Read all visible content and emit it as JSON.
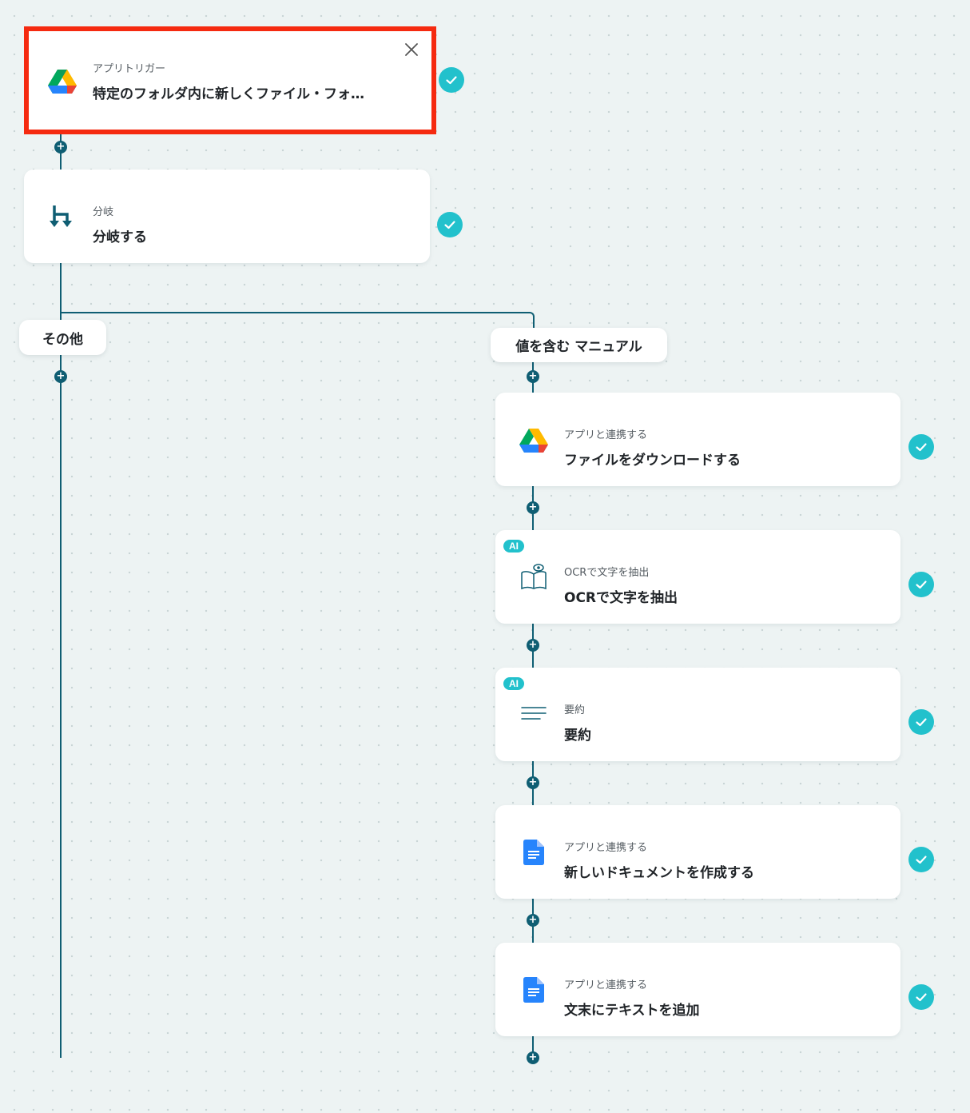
{
  "trigger": {
    "sub": "アプリトリガー",
    "main": "特定のフォルダ内に新しくファイル・フォ…",
    "icon": "google-drive-icon"
  },
  "branch": {
    "sub": "分岐",
    "main": "分岐する",
    "icon": "branch-icon"
  },
  "branches": {
    "left": "その他",
    "right": "値を含む マニュアル"
  },
  "steps": [
    {
      "sub": "アプリと連携する",
      "main": "ファイルをダウンロードする",
      "icon": "google-drive-icon",
      "ai": false
    },
    {
      "sub": "OCRで文字を抽出",
      "main": "OCRで文字を抽出",
      "icon": "ocr-book-icon",
      "ai": true,
      "badge": "AI"
    },
    {
      "sub": "要約",
      "main": "要約",
      "icon": "summary-lines-icon",
      "ai": true,
      "badge": "AI"
    },
    {
      "sub": "アプリと連携する",
      "main": "新しいドキュメントを作成する",
      "icon": "google-docs-icon",
      "ai": false
    },
    {
      "sub": "アプリと連携する",
      "main": "文末にテキストを追加",
      "icon": "google-docs-icon",
      "ai": false
    }
  ],
  "add_symbol": "+",
  "colors": {
    "line": "#0f5e73",
    "check": "#22c1cc",
    "selected_border": "#f52a10",
    "background": "#edf3f3"
  }
}
